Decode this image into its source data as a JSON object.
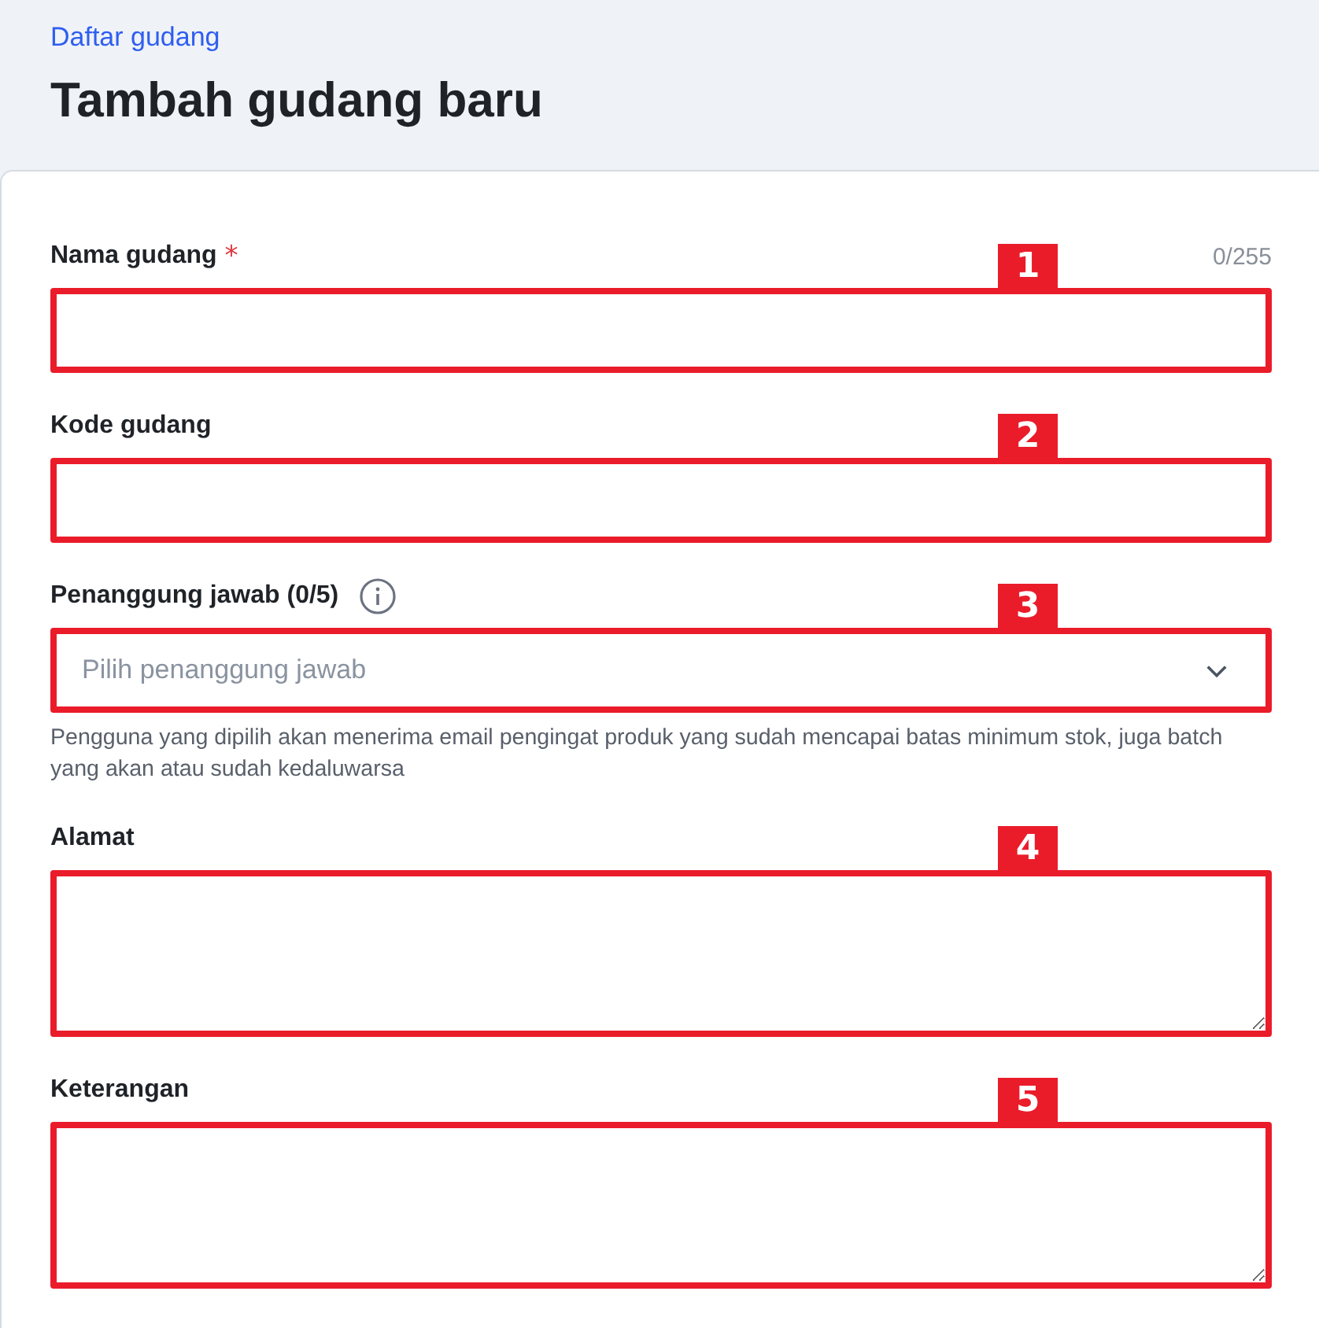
{
  "breadcrumb": "Daftar gudang",
  "title": "Tambah gudang baru",
  "fields": [
    {
      "kind": "text",
      "label": "Nama gudang",
      "required": true,
      "required_mark": "*",
      "counter": "0/255",
      "marker": "1"
    },
    {
      "kind": "text",
      "label": "Kode gudang",
      "required": false,
      "marker": "2"
    },
    {
      "kind": "select",
      "label": "Penanggung jawab (0/5)",
      "required": false,
      "info": true,
      "placeholder": "Pilih penanggung jawab",
      "helper": "Pengguna yang dipilih akan menerima email pengingat produk yang sudah mencapai batas minimum stok, juga batch yang akan atau sudah kedaluwarsa",
      "marker": "3"
    },
    {
      "kind": "textarea",
      "label": "Alamat",
      "required": false,
      "marker": "4"
    },
    {
      "kind": "textarea",
      "label": "Keterangan",
      "required": false,
      "marker": "5"
    }
  ]
}
